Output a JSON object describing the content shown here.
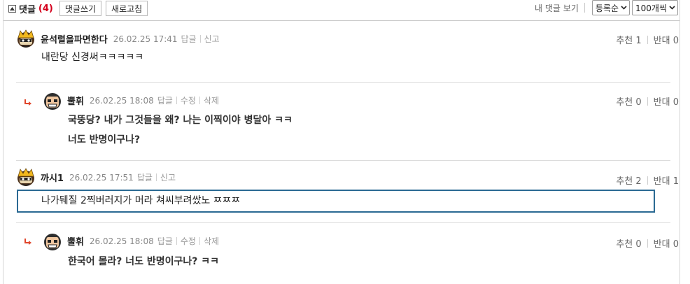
{
  "toolbar": {
    "title": "댓글",
    "count": "(4)",
    "write_label": "댓글쓰기",
    "refresh_label": "새로고침",
    "my_comments": "내 댓글 보기",
    "sort_value": "등록순",
    "page_size_value": "100개씩"
  },
  "comments": [
    {
      "nick": "윤석렬을파면한다",
      "date": "26.02.25 17:41",
      "actions": [
        "답글",
        "신고"
      ],
      "lines": [
        "내란당 신경써ㅋㅋㅋㅋㅋ"
      ],
      "up_label": "추천 1",
      "down_label": "반대 0",
      "reply": false
    },
    {
      "nick": "뿔휘",
      "date": "26.02.25 18:08",
      "actions": [
        "답글",
        "수정",
        "삭제"
      ],
      "lines": [
        "국뚱당? 내가 그것들을 왜? 나는 이찍이야 병달아 ㅋㅋ",
        "너도 반명이구나?"
      ],
      "up_label": "추천 0",
      "down_label": "반대 0",
      "reply": true
    },
    {
      "nick": "까시1",
      "date": "26.02.25 17:51",
      "actions": [
        "답글",
        "신고"
      ],
      "lines": [
        "나가뒈질 2찍버러지가 머라 쳐씨부려쌌노 ㅉㅉㅉ"
      ],
      "up_label": "추천 2",
      "down_label": "반대 1",
      "reply": false
    },
    {
      "nick": "뿔휘",
      "date": "26.02.25 18:08",
      "actions": [
        "답글",
        "수정",
        "삭제"
      ],
      "lines": [
        "한국어 몰라? 너도 반명이구나? ㅋㅋ"
      ],
      "up_label": "추천 0",
      "down_label": "반대 0",
      "reply": true
    }
  ],
  "colors": {
    "count": "#d4001c",
    "reply_arrow": "#e0462c",
    "focus": "#2b6a93"
  },
  "icons": {
    "toggle": "collapse-triangle-icon",
    "reply": "reply-arrow-icon",
    "select": "chevron-down-icon"
  }
}
